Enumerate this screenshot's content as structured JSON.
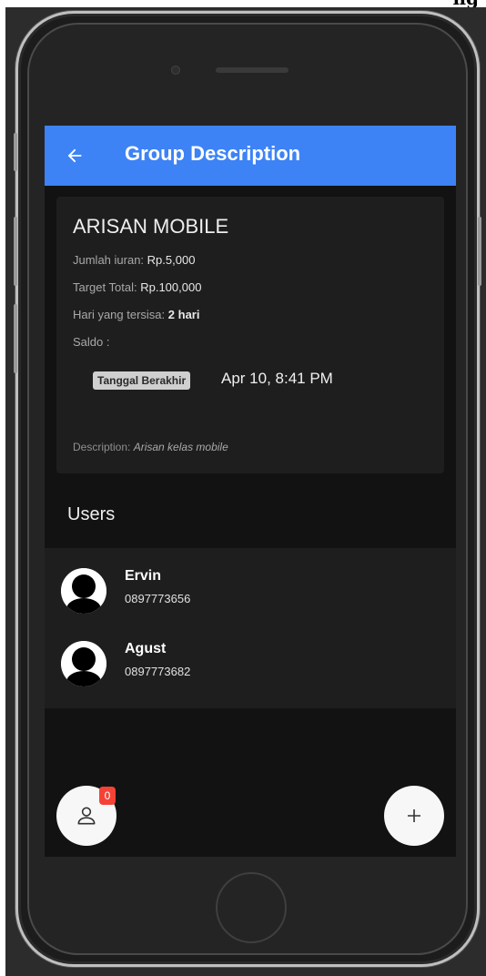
{
  "top_strip": {
    "text": "ng"
  },
  "appbar": {
    "title": "Group Description",
    "back_icon": "arrow-left-icon"
  },
  "group": {
    "name": "ARISAN MOBILE",
    "jumlah_label": "Jumlah iuran:",
    "jumlah_value": "Rp.5,000",
    "target_label": "Target Total:",
    "target_value": "Rp.100,000",
    "hari_label": "Hari yang tersisa:",
    "hari_value": "2 hari",
    "saldo_label": "Saldo :",
    "end_chip": "Tanggal Berakhir",
    "end_date": "Apr 10, 8:41 PM",
    "description_label": "Description:",
    "description_value": "Arisan kelas mobile"
  },
  "users": {
    "title": "Users",
    "items": [
      {
        "name": "Ervin",
        "phone": "0897773656"
      },
      {
        "name": "Agust",
        "phone": "0897773682"
      }
    ]
  },
  "fab": {
    "members_icon": "person-icon",
    "members_badge": "0",
    "add_icon": "plus-icon"
  },
  "colors": {
    "appbar": "#3d83f6",
    "screen_bg": "#121212",
    "card_bg": "#1e1e1e",
    "badge": "#f44336"
  }
}
